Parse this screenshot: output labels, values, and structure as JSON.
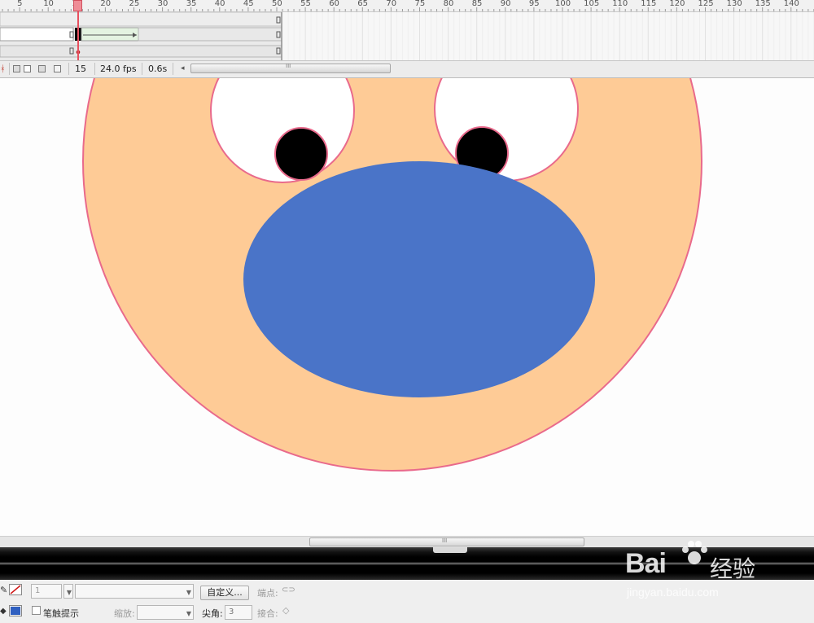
{
  "timeline": {
    "ruler_labels": [
      "5",
      "10",
      "15",
      "20",
      "25",
      "30",
      "35",
      "40",
      "45",
      "50",
      "55",
      "60",
      "65",
      "70",
      "75",
      "80",
      "85",
      "90",
      "95",
      "100",
      "105",
      "110",
      "115",
      "120",
      "125",
      "130",
      "135",
      "140"
    ],
    "current_frame": "15",
    "fps": "24.0 fps",
    "elapsed_time": "0.6s",
    "scroll_left_arrow": "◂",
    "scroll_thumb_grip": "III"
  },
  "stage": {
    "face_fill": "#fecb96",
    "outline": "#e96a8c",
    "eye_fill": "#ffffff",
    "pupil_fill": "#000000",
    "mouth_fill": "#4a74c8"
  },
  "scrollbar": {
    "grip": "III"
  },
  "properties": {
    "stroke_size_value": "1",
    "customize_button": "自定义...",
    "cap_label": "端点:",
    "stroke_hinting_label": "笔触提示",
    "scale_label": "缩放:",
    "miter_label": "尖角:",
    "miter_value": "3",
    "join_label": "接合:",
    "fill_color": "#2f5fc0"
  },
  "watermark": {
    "brand": "Bai",
    "brand_suffix": "经验",
    "url": "jingyan.baidu.com"
  }
}
